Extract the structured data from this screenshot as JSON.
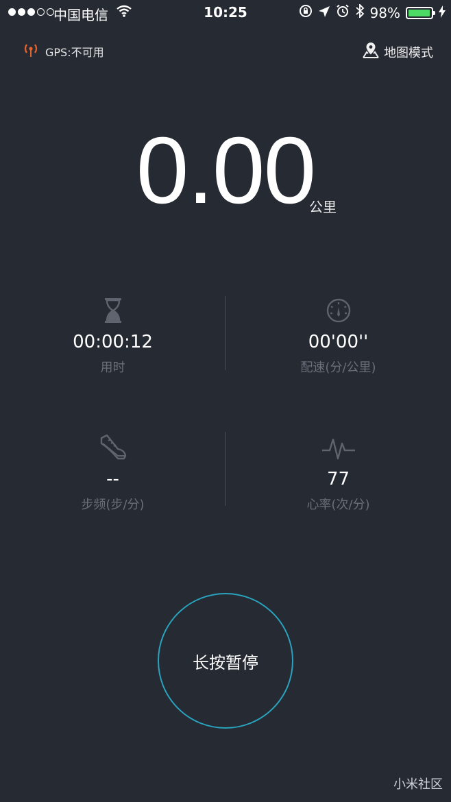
{
  "status_bar": {
    "carrier": "中国电信",
    "time": "10:25",
    "battery_percent": "98%",
    "battery_level": 0.98,
    "signal_bars_filled": 3,
    "signal_bars_total": 5
  },
  "gps": {
    "label": "GPS:不可用",
    "icon": "gps-antenna-icon",
    "icon_color": "#e8622c"
  },
  "map_mode": {
    "label": "地图模式",
    "icon": "map-pin-icon"
  },
  "distance": {
    "value": "0.00",
    "unit": "公里"
  },
  "stats": {
    "duration": {
      "value": "00:00:12",
      "label": "用时",
      "icon": "hourglass-icon"
    },
    "pace": {
      "value": "00'00''",
      "label": "配速(分/公里)",
      "icon": "speedometer-icon"
    },
    "cadence": {
      "value": "--",
      "label": "步频(步/分)",
      "icon": "shoe-icon"
    },
    "heart_rate": {
      "value": "77",
      "label": "心率(次/分)",
      "icon": "heartbeat-icon"
    }
  },
  "pause_button": {
    "label": "长按暂停",
    "border_color": "#2aa3be"
  },
  "watermark": "小米社区",
  "colors": {
    "background": "#262a33",
    "label_gray": "#6a6f79"
  }
}
